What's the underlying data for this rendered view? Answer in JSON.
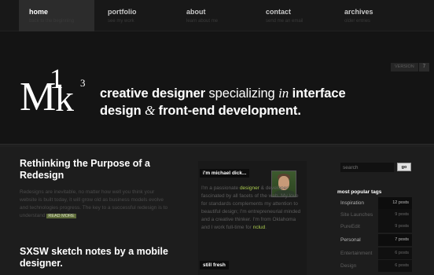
{
  "nav": {
    "items": [
      {
        "label": "home",
        "sub": "back to the beginning"
      },
      {
        "label": "portfolio",
        "sub": "see my work"
      },
      {
        "label": "about",
        "sub": "learn about me"
      },
      {
        "label": "contact",
        "sub": "send me an email"
      },
      {
        "label": "archives",
        "sub": "older entries"
      }
    ]
  },
  "header": {
    "version_label": "VERSION",
    "version_number": "7",
    "logo": {
      "m": "M",
      "one": "1",
      "k": "k",
      "three": "3"
    },
    "tagline": {
      "part1": "creative designer",
      "part2": " specializing ",
      "part3": "in",
      "part4": " interface design ",
      "part5": "&",
      "part6": " front-end development."
    }
  },
  "posts": [
    {
      "title": "Rethinking the Purpose of a Redesign",
      "excerpt": "Redesigns are inevitable, no matter how well you think your website is built today, it will grow old as business models evolve and technologies progress. The key to a successful redesign is to understand",
      "read_more": "READ MORE"
    },
    {
      "title": "SXSW sketch notes by a mobile designer."
    }
  ],
  "about": {
    "heading": "i'm michael dick...",
    "t1": "I'm a passionate ",
    "t2": "designer",
    "t3": " & developer fascinated by all facets of the web. My love for standards complements my attention to beautiful design; I'm entrepreneurial minded and a creative thinker. I'm from Oklahoma and I work full-time for ",
    "t4": "nclud",
    "t5": ".",
    "still_fresh": "still fresh"
  },
  "sidebar": {
    "search_placeholder": "search",
    "search_button": "go",
    "tags_heading": "most popular tags",
    "tags": [
      {
        "name": "Inspiration",
        "count": "12 posts"
      },
      {
        "name": "Site Launches",
        "count": "9 posts"
      },
      {
        "name": "PureEdit",
        "count": "9 posts"
      },
      {
        "name": "Personal",
        "count": "7 posts"
      },
      {
        "name": "Entertainment",
        "count": "6 posts"
      },
      {
        "name": "Design",
        "count": "6 posts"
      }
    ]
  },
  "colors": {
    "accent": "#a8c84e",
    "read_more_bg": "#5e6b3a",
    "background": "#1b1b1b"
  }
}
